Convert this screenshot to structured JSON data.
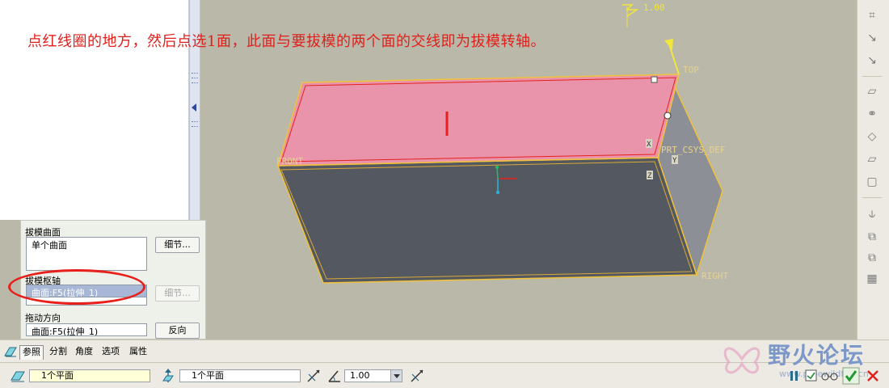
{
  "instruction": "点红线圈的地方，然后点选1面，此面与要拔模的两个面的交线即为拔模转轴。",
  "viewport": {
    "datum_labels": {
      "top": "TOP",
      "front": "FRONT",
      "right": "RIGHT",
      "csys": "PRT_CSYS_DEF",
      "csys_x": "X",
      "csys_z": "Z",
      "csys_y": "Y",
      "dimension": "1.00"
    },
    "face_marker": "1",
    "colors": {
      "background": "#b9b8a9",
      "selected_face": "#e994ab",
      "front_face": "#545860",
      "side_face": "#8c9096",
      "edge_highlight": "#f2c23a",
      "annotation_red": "#e8201c"
    }
  },
  "ref_panel": {
    "draft_surfaces_label": "拔模曲面",
    "draft_surfaces_value": "单个曲面",
    "details_button": "细节...",
    "draft_hinges_label": "拔模枢轴",
    "draft_hinges_value": "曲面:F5(拉伸_1)",
    "hinge_details_button": "细节...",
    "pull_direction_label": "拖动方向",
    "pull_direction_value": "曲面:F5(拉伸_1)",
    "flip_button": "反向"
  },
  "tabs": [
    "参照",
    "分割",
    "角度",
    "选项",
    "属性"
  ],
  "active_tab": "参照",
  "dashboard": {
    "hinge_field": "1个平面",
    "direction_field": "1个平面",
    "angle_value": "1.00"
  },
  "watermark": {
    "title": "野火论坛",
    "url": "www.proewildfire.cn"
  },
  "right_toolbar_icons": [
    "datum-plane-icon",
    "axis-icon",
    "curve-icon",
    "point-icon",
    "csys-icon",
    "hole-icon",
    "round-icon",
    "chamfer-icon",
    "draft-icon",
    "shell-icon",
    "rib-icon",
    "mirror-icon",
    "merge-icon",
    "trim-icon",
    "pattern-icon"
  ]
}
